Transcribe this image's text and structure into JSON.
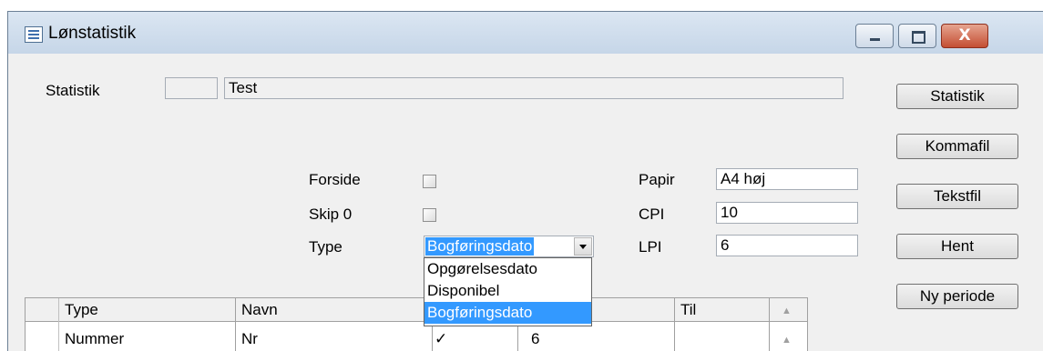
{
  "window": {
    "title": "Lønstatistik",
    "close_label": "X"
  },
  "statistik": {
    "label": "Statistik",
    "number": "",
    "name": "Test"
  },
  "options": {
    "forside_label": "Forside",
    "forside_checked": false,
    "skip0_label": "Skip 0",
    "skip0_checked": false,
    "type_label": "Type",
    "type_value": "Bogføringsdato",
    "type_options": [
      "Opgørelsesdato",
      "Disponibel",
      "Bogføringsdato"
    ]
  },
  "print": {
    "papir_label": "Papir",
    "papir_value": "A4 høj",
    "cpi_label": "CPI",
    "cpi_value": "10",
    "lpi_label": "LPI",
    "lpi_value": "6"
  },
  "buttons": [
    "Statistik",
    "Kommafil",
    "Tekstfil",
    "Hent",
    "Ny periode"
  ],
  "table": {
    "headers": [
      "Type",
      "Navn",
      "",
      "Til"
    ],
    "rows": [
      {
        "type": "Nummer",
        "navn": "Nr",
        "check": "✓",
        "value": "6",
        "til": ""
      }
    ]
  }
}
